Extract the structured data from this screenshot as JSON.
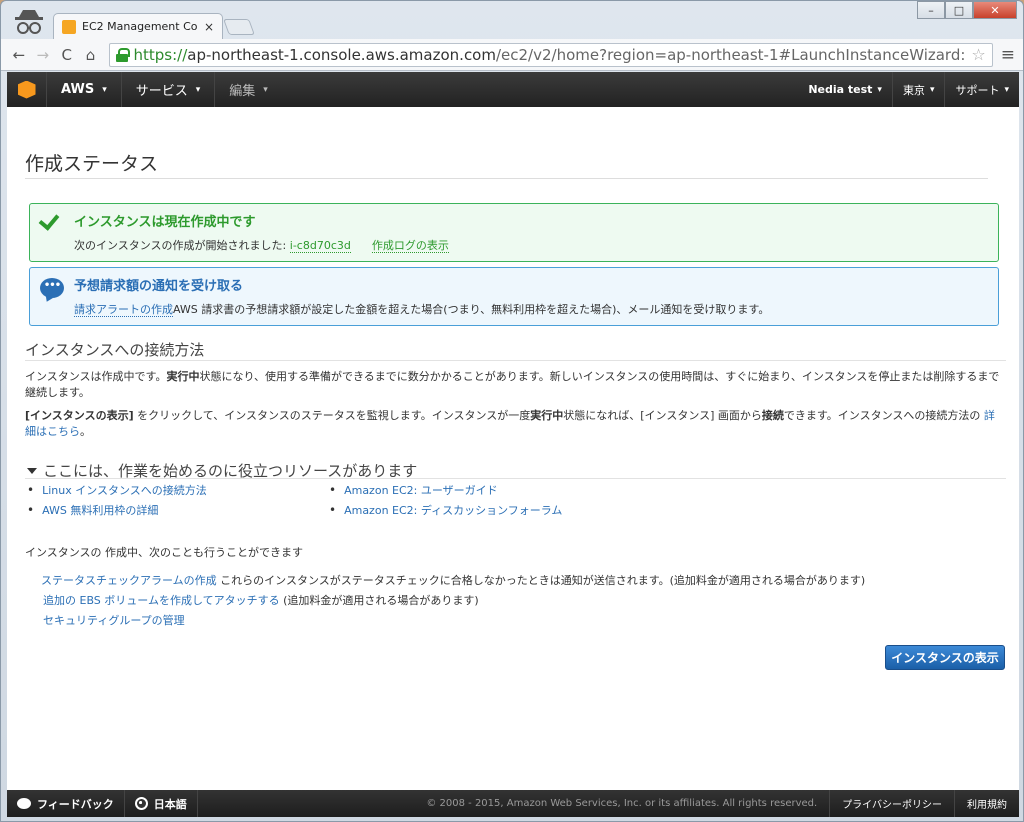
{
  "browser": {
    "tab_title": "EC2 Management Cons",
    "tab_close": "×",
    "url_scheme": "https://",
    "url_host": "ap-northeast-1.console.aws.amazon.com",
    "url_path": "/ec2/v2/home?region=ap-northeast-1#LaunchInstanceWizard:",
    "controls": {
      "minimize": "–",
      "maximize": "□",
      "close": "✕"
    },
    "back": "←",
    "forward": "→",
    "reload": "C",
    "home": "⌂",
    "star": "☆",
    "menu": "≡"
  },
  "aws_header": {
    "aws_label": "AWS",
    "services_label": "サービス",
    "edit_label": "編集",
    "caret": "▾",
    "user_label": "Nedia test",
    "region_label": "東京",
    "support_label": "サポート"
  },
  "page": {
    "title": "作成ステータス",
    "success_alert": {
      "heading": "インスタンスは現在作成中です",
      "body_prefix": "次のインスタンスの作成が開始されました:",
      "instance_id": "i-c8d70c3d",
      "log_link": "作成ログの表示"
    },
    "info_alert": {
      "icon_text": "•••",
      "heading": "予想請求額の通知を受け取る",
      "link": "請求アラートの作成",
      "body": "AWS 請求書の予想請求額が設定した金額を超えた場合(つまり、無料利用枠を超えた場合)、メール通知を受け取ります。"
    },
    "connect": {
      "title": "インスタンスへの接続方法",
      "p1_a": "インスタンスは作成中です。",
      "p1_b": "実行中",
      "p1_c": "状態になり、使用する準備ができるまでに数分かかることがあります。新しいインスタンスの使用時間は、すぐに始まり、インスタンスを停止または削除するまで継続します。",
      "p2_a": "[インスタンスの表示]",
      "p2_b": " をクリックして、インスタンスのステータスを監視します。インスタンスが一度",
      "p2_c": "実行中",
      "p2_d": "状態になれば、[インスタンス] 画面から",
      "p2_e": "接続",
      "p2_f": "できます。インスタンスへの接続方法の ",
      "p2_link": "詳細はこちら",
      "p2_end": "。"
    },
    "resources": {
      "title": "ここには、作業を始めるのに役立つリソースがあります",
      "left": [
        "Linux インスタンスへの接続方法",
        "AWS 無料利用枠の詳細"
      ],
      "right": [
        "Amazon EC2: ユーザーガイド",
        "Amazon EC2: ディスカッションフォーラム"
      ]
    },
    "extras": {
      "title": "インスタンスの 作成中、次のことも行うことができます",
      "item1_link": "ステータスチェックアラームの作成",
      "item1_text": " これらのインスタンスがステータスチェックに合格しなかったときは通知が送信されます。(追加料金が適用される場合があります)",
      "item2_link": "追加の EBS ボリュームを作成してアタッチする",
      "item2_text": " (追加料金が適用される場合があります)",
      "item3_link": "セキュリティグループの管理"
    },
    "view_instances_button": "インスタンスの表示"
  },
  "footer": {
    "feedback": "フィードバック",
    "language": "日本語",
    "copyright": "© 2008 - 2015, Amazon Web Services, Inc. or its affiliates. All rights reserved.",
    "privacy": "プライバシーポリシー",
    "terms": "利用規約"
  }
}
